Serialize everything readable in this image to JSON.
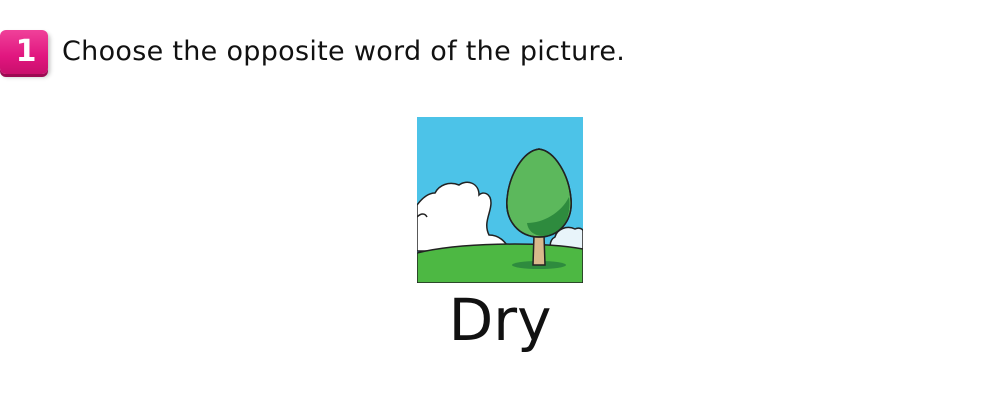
{
  "question": {
    "number": "1",
    "instruction": "Choose the opposite word of the picture."
  },
  "picture": {
    "subject_icon": "tree-icon",
    "colors": {
      "sky": "#4cc3e8",
      "grass": "#4db843",
      "tree_light": "#5cb85c",
      "tree_dark": "#2e8b3e",
      "trunk": "#d9b98c",
      "cloud": "#ffffff"
    }
  },
  "word": {
    "text": "Dry"
  }
}
